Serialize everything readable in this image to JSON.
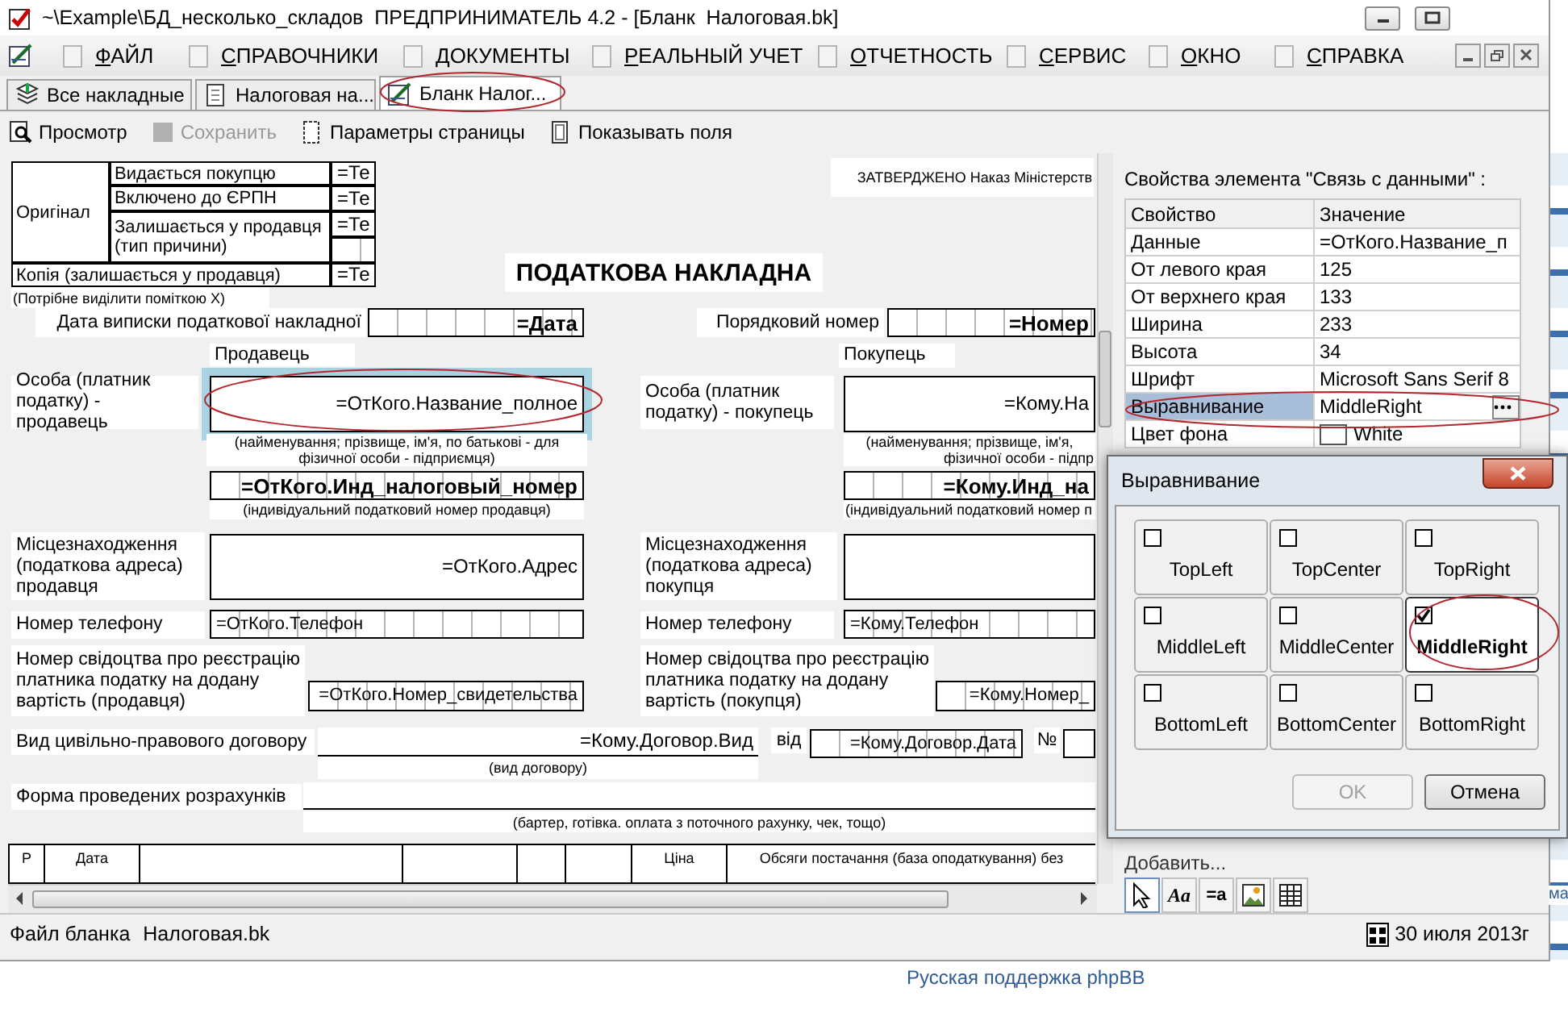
{
  "window": {
    "title": "~\\Example\\БД_несколько_складов  ПРЕДПРИНИМАТЕЛЬ 4.2 - [Бланк  Налоговая.bk]"
  },
  "menu": [
    {
      "label": "ФАЙЛ"
    },
    {
      "label": "СПРАВОЧНИКИ"
    },
    {
      "label": "ДОКУМЕНТЫ"
    },
    {
      "label": "РЕАЛЬНЫЙ УЧЕТ"
    },
    {
      "label": "ОТЧЕТНОСТЬ"
    },
    {
      "label": "СЕРВИС"
    },
    {
      "label": "ОКНО"
    },
    {
      "label": "СПРАВКА"
    }
  ],
  "tabs": [
    {
      "label": "Все накладные",
      "selected": false
    },
    {
      "label": "Налоговая на...",
      "selected": false
    },
    {
      "label": "Бланк  Налог...",
      "selected": true
    }
  ],
  "toolbar": [
    {
      "label": "Просмотр",
      "disabled": false
    },
    {
      "label": "Сохранить",
      "disabled": true
    },
    {
      "label": "Параметры страницы",
      "disabled": false
    },
    {
      "label": "Показывать поля",
      "disabled": false
    }
  ],
  "form": [
    {
      "kind": "cell",
      "text": "Оригінал"
    },
    {
      "kind": "cell",
      "text": "Видається покупцю"
    },
    {
      "kind": "field",
      "text": "=Те",
      "selected": false
    },
    {
      "kind": "cell",
      "text": "Включено до ЄРПН"
    },
    {
      "kind": "field",
      "text": "=Те",
      "selected": false
    },
    {
      "kind": "cell",
      "text": "Залишається у продавця (тип причини)"
    },
    {
      "kind": "field",
      "text": "=Те",
      "selected": false
    },
    {
      "kind": "cellfield",
      "selected": false
    },
    {
      "kind": "cell",
      "text": "Копія (залишається у продавця)"
    },
    {
      "kind": "field",
      "text": "=Те",
      "selected": false
    },
    {
      "kind": "note",
      "text": "(Потрібне виділити поміткою Х)"
    },
    {
      "kind": "note",
      "text": "ЗАТВЕРДЖЕНО Наказ Міністерств"
    },
    {
      "kind": "heading",
      "text": "ПОДАТКОВА НАКЛАДНА"
    },
    {
      "kind": "label",
      "text": "Дата виписки податкової накладної"
    },
    {
      "kind": "keyfield",
      "text": "=Дата",
      "selected": false
    },
    {
      "kind": "label",
      "text": "Порядковий номер"
    },
    {
      "kind": "keyfield",
      "text": "=Номер",
      "selected": false
    },
    {
      "kind": "label",
      "text": "Продавець"
    },
    {
      "kind": "label",
      "text": "Покупець"
    },
    {
      "kind": "label",
      "text": "Особа (платник податку) - продавець"
    },
    {
      "kind": "field",
      "text": "=ОтКого.Название_полное",
      "selected": true
    },
    {
      "kind": "note",
      "text": "(найменування; прізвище, ім'я, по батькові - для фізичної особи - підприємця)"
    },
    {
      "kind": "label",
      "text": "Особа (платник податку) - покупець"
    },
    {
      "kind": "field",
      "text": "=Кому.На",
      "selected": false
    },
    {
      "kind": "note",
      "text": "(найменування; прізвище, ім'я,"
    },
    {
      "kind": "note",
      "text": "фізичної особи - підпр"
    },
    {
      "kind": "keyfield",
      "text": "=ОтКого.Инд_налоговый_номер",
      "selected": false
    },
    {
      "kind": "note",
      "text": "(індивідуальний податковий номер продавця)"
    },
    {
      "kind": "keyfield",
      "text": "=Кому.Инд_на",
      "selected": false
    },
    {
      "kind": "note",
      "text": "(індивідуальний податковий номер п"
    },
    {
      "kind": "label",
      "text": "Місцезнаходження (податкова адреса) продавця"
    },
    {
      "kind": "field",
      "text": "=ОтКого.Адрес",
      "selected": false
    },
    {
      "kind": "label",
      "text": "Місцезнаходження (податкова адреса) покупця"
    },
    {
      "kind": "field",
      "selected": false
    },
    {
      "kind": "label",
      "text": "Номер телефону"
    },
    {
      "kind": "cellfield",
      "text": "=ОтКого.Телефон",
      "selected": false
    },
    {
      "kind": "label",
      "text": "Номер телефону"
    },
    {
      "kind": "cellfield",
      "text": "=Кому.Телефон",
      "selected": false
    },
    {
      "kind": "label",
      "text": "Номер свідоцтва про реєстрацію платника податку на додану вартість (продавця)"
    },
    {
      "kind": "cellfield",
      "text": "=ОтКого.Номер_свидетельства",
      "selected": false
    },
    {
      "kind": "label",
      "text": "Номер свідоцтва про реєстрацію платника податку на додану вартість (покупця)"
    },
    {
      "kind": "cellfield",
      "text": "=Кому.Номер_",
      "selected": false
    },
    {
      "kind": "label",
      "text": "Вид цивільно-правового договору"
    },
    {
      "kind": "linefield",
      "text": "=Кому.Договор.Вид",
      "selected": false
    },
    {
      "kind": "note",
      "text": "(вид договору)"
    },
    {
      "kind": "label",
      "text": "від"
    },
    {
      "kind": "cellfield",
      "text": "=Кому.Договор.Дата",
      "selected": false
    },
    {
      "kind": "label",
      "text": "№"
    },
    {
      "kind": "field",
      "selected": false
    },
    {
      "kind": "label",
      "text": "Форма проведених розрахунків"
    },
    {
      "kind": "linefield",
      "selected": false
    },
    {
      "kind": "note",
      "text": "(бартер, готівка. оплата з поточного рахунку, чек, тощо)"
    },
    {
      "kind": "colhead",
      "text": "Р"
    },
    {
      "kind": "colhead",
      "text": "Дата"
    },
    {
      "kind": "colhead"
    },
    {
      "kind": "colhead"
    },
    {
      "kind": "colhead"
    },
    {
      "kind": "colhead"
    },
    {
      "kind": "colhead",
      "text": "Ціна"
    },
    {
      "kind": "colhead",
      "text": "Обсяги постачання (база оподаткування) без"
    }
  ],
  "properties": {
    "title": "Свойства элемента \"Связь с данными\" :",
    "columns": [
      "Свойство",
      "Значение"
    ],
    "rows": [
      {
        "name": "Данные",
        "value": "=ОтКого.Название_п",
        "kind": "text",
        "selected": false
      },
      {
        "name": "От левого края",
        "value": "125",
        "kind": "text",
        "selected": false
      },
      {
        "name": "От верхнего края",
        "value": "133",
        "kind": "text",
        "selected": false
      },
      {
        "name": "Ширина",
        "value": "233",
        "kind": "text",
        "selected": false
      },
      {
        "name": "Высота",
        "value": "34",
        "kind": "text",
        "selected": false
      },
      {
        "name": "Шрифт",
        "value": "Microsoft Sans Serif 8",
        "kind": "text",
        "selected": false
      },
      {
        "name": "Выравнивание",
        "value": "MiddleRight",
        "kind": "choice",
        "selected": true
      },
      {
        "name": "Цвет фона",
        "value": "White",
        "kind": "color",
        "selected": false
      }
    ]
  },
  "add_panel": {
    "label": "Добавить...",
    "tools": [
      {
        "kind": "pointer",
        "selected": true
      },
      {
        "kind": "text",
        "label": "Aa",
        "selected": false
      },
      {
        "kind": "text",
        "label": "=a",
        "selected": false
      },
      {
        "kind": "picture",
        "selected": false
      },
      {
        "kind": "table",
        "selected": false
      }
    ]
  },
  "status_bar": {
    "file_label": "Файл бланка",
    "file_name": "Налоговая.bk",
    "date": "30 июля 2013г"
  },
  "dialog": {
    "title": "Выравнивание",
    "options": [
      {
        "label": "TopLeft",
        "checked": false
      },
      {
        "label": "TopCenter",
        "checked": false
      },
      {
        "label": "TopRight",
        "checked": false
      },
      {
        "label": "MiddleLeft",
        "checked": false
      },
      {
        "label": "MiddleCenter",
        "checked": false
      },
      {
        "label": "MiddleRight",
        "checked": true
      },
      {
        "label": "BottomLeft",
        "checked": false
      },
      {
        "label": "BottomCenter",
        "checked": false
      },
      {
        "label": "BottomRight",
        "checked": false
      }
    ],
    "buttons": [
      {
        "label": "OK",
        "disabled": true
      },
      {
        "label": "Отмена",
        "disabled": false
      }
    ]
  },
  "background": {
    "link": "Русская поддержка phpBB",
    "fragment": "ма"
  }
}
